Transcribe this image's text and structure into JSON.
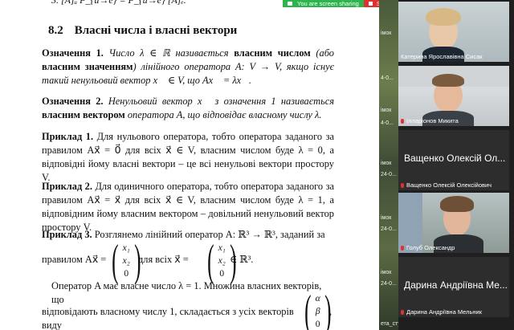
{
  "document": {
    "top_formula": "3. [A]ᵤ P_{u→e} = P_{u→e} [A]ₑ.",
    "section": {
      "number": "8.2",
      "title": "Власні числа і власні вектори"
    },
    "def1": {
      "label": "Означення 1.",
      "t1": "Число λ ∈ ℝ називається",
      "term1": "власним числом",
      "t2": "(або",
      "term2": "власним значенням",
      "t3": ") лінійного оператора A: V → V, якщо існує такий ненульовий вектор x⃗ ∈ V, що Ax⃗ = λx⃗."
    },
    "def2": {
      "label": "Означення 2.",
      "t1": "Ненульовий вектор x⃗ з означення 1 називається",
      "term": "власним вектором",
      "t2": "оператора A, що відповідає власному числу λ."
    },
    "ex1": {
      "label": "Приклад 1.",
      "text": "Для нульового оператора, тобто оператора заданого за правилом Ax⃗ = 0⃗ для всіх x⃗ ∈ V, власним числом буде λ = 0, а відповідні йому власні вектори – це всі ненульові вектори простору V."
    },
    "ex2": {
      "label": "Приклад 2.",
      "text": "Для одиничного оператора, тобто оператора заданого за правилом Ax⃗ = x⃗ для всіх x⃗ ∈ V, власним числом буде λ = 1, а відповідним йому власним вектором – довільний ненульовий вектор простору V."
    },
    "ex3": {
      "label": "Приклад 3.",
      "t1": "Розглянемо лінійний оператор A: ℝ³ → ℝ³, заданий за",
      "t2": "правилом Ax⃗ =",
      "m1": [
        "x₁",
        "x₂",
        "0"
      ],
      "t3": "для всіх x⃗ =",
      "m2": [
        "x₁",
        "x₂",
        "0"
      ],
      "t4": "∈ ℝ³."
    },
    "para": {
      "t1": "Оператор A має власне число λ = 1. Множина власних векторів, що",
      "t2": "відповідають власному числу 1, складається з усіх векторів виду",
      "m": [
        "α",
        "β",
        "0"
      ],
      "t3": ","
    }
  },
  "share_bar": {
    "status": "You are screen sharing",
    "stop": "Stop Share"
  },
  "desktop_labels": [
    "імок",
    "4-0...",
    "імок",
    "4-0...",
    "імок",
    "24-0...",
    "імок",
    "24-0...",
    "імок",
    "24-0...",
    "ета_студентів"
  ],
  "participants": [
    {
      "name": "Катерина Ярославівна Сисак",
      "muted": false
    },
    {
      "name": "Ілларіонов Микита",
      "muted": true
    },
    {
      "name": "Ващенко Олексій Олексійович",
      "display": "Ващенко Олексій Ол...",
      "muted": true
    },
    {
      "name": "Голуб Олександр",
      "muted": true
    },
    {
      "name": "Дарина Андріївна Мельник",
      "display": "Дарина Андріївна Ме...",
      "muted": true
    }
  ],
  "colors": {
    "share_green": "#2bb54c",
    "stop_red": "#e0302f",
    "panel_bg": "#1f1f1f"
  }
}
